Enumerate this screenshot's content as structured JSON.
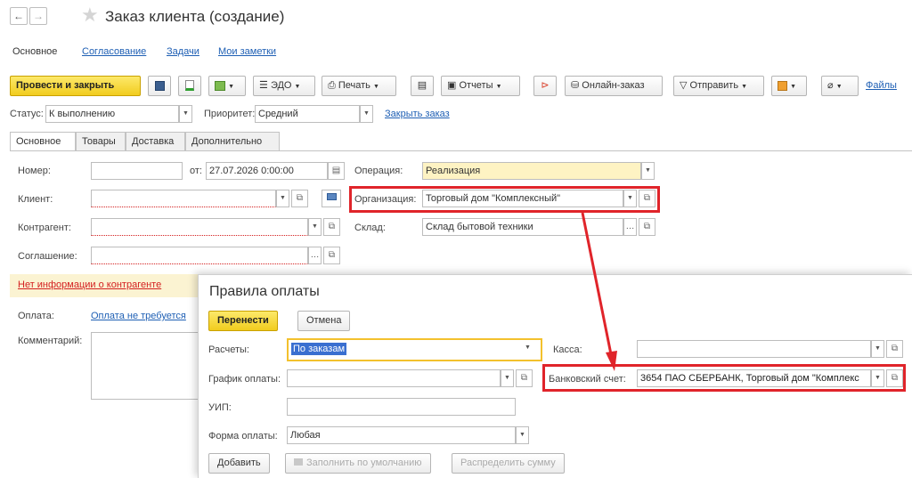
{
  "window": {
    "title": "Заказ клиента (создание)"
  },
  "page_tabs": [
    "Основное",
    "Согласование",
    "Задачи",
    "Мои заметки"
  ],
  "toolbar": {
    "post_close": "Провести и закрыть",
    "edo": "ЭДО",
    "print": "Печать",
    "reports": "Отчеты",
    "online_order": "Онлайн-заказ",
    "send": "Отправить",
    "files": "Файлы"
  },
  "status_row": {
    "status_label": "Статус:",
    "status_value": "К выполнению",
    "priority_label": "Приоритет:",
    "priority_value": "Средний",
    "close_order": "Закрыть заказ"
  },
  "form_tabs": [
    "Основное",
    "Товары",
    "Доставка",
    "Дополнительно"
  ],
  "form": {
    "number_label": "Номер:",
    "number_value": "",
    "date_label": "от:",
    "date_value": "27.07.2026  0:00:00",
    "operation_label": "Операция:",
    "operation_value": "Реализация",
    "client_label": "Клиент:",
    "client_value": "",
    "organization_label": "Организация:",
    "organization_value": "Торговый дом \"Комплексный\"",
    "counterparty_label": "Контрагент:",
    "counterparty_value": "",
    "warehouse_label": "Склад:",
    "warehouse_value": "Склад бытовой техники",
    "agreement_label": "Соглашение:",
    "agreement_value": "",
    "no_info": "Нет информации о контрагенте",
    "payment_label": "Оплата:",
    "payment_value": "Оплата не требуется",
    "comment_label": "Комментарий:"
  },
  "dialog": {
    "title": "Правила оплаты",
    "transfer": "Перенести",
    "cancel": "Отмена",
    "settlements_label": "Расчеты:",
    "settlements_value": "По заказам",
    "cash_label": "Касса:",
    "cash_value": "",
    "schedule_label": "График оплаты:",
    "schedule_value": "",
    "bank_label": "Банковский счет:",
    "bank_value": "3654 ПАО СБЕРБАНК, Торговый дом \"Комплекс",
    "uip_label": "УИП:",
    "uip_value": "",
    "form_label": "Форма оплаты:",
    "form_value": "Любая",
    "add": "Добавить",
    "fill_default": "Заполнить по умолчанию",
    "distribute": "Распределить сумму"
  },
  "colors": {
    "accent_yellow": "#f3cd22",
    "highlight_red": "#e0242a",
    "link_blue": "#1e5fb4"
  }
}
